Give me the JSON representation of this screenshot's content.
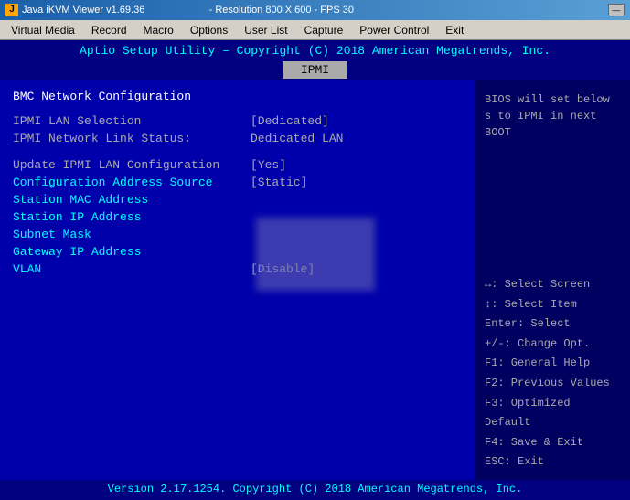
{
  "titlebar": {
    "text": "Java iKVM Viewer v1.69.36",
    "resolution": "- Resolution 800 X 600 - FPS 30",
    "minimize_label": "—"
  },
  "menubar": {
    "items": [
      {
        "label": "Virtual Media"
      },
      {
        "label": "Record"
      },
      {
        "label": "Macro"
      },
      {
        "label": "Options"
      },
      {
        "label": "User List"
      },
      {
        "label": "Capture"
      },
      {
        "label": "Power Control"
      },
      {
        "label": "Exit"
      }
    ]
  },
  "bios": {
    "header": "Aptio Setup Utility – Copyright (C) 2018 American Megatrends, Inc.",
    "tab": "IPMI",
    "section_title": "BMC Network Configuration",
    "rows": [
      {
        "label": "IPMI LAN Selection",
        "value": "[Dedicated]",
        "highlighted": false
      },
      {
        "label": "IPMI Network Link Status:",
        "value": "Dedicated LAN",
        "highlighted": false
      },
      {
        "spacer": true
      },
      {
        "label": "Update IPMI LAN Configuration",
        "value": "[Yes]",
        "highlighted": false
      },
      {
        "label": "Configuration Address Source",
        "value": "[Static]",
        "highlighted": true
      },
      {
        "label": "Station MAC Address",
        "value": "",
        "highlighted": true
      },
      {
        "label": "Station IP Address",
        "value": "",
        "highlighted": true
      },
      {
        "label": "Subnet Mask",
        "value": "",
        "highlighted": true
      },
      {
        "label": "Gateway IP Address",
        "value": "",
        "highlighted": true
      },
      {
        "label": "VLAN",
        "value": "[Disable]",
        "highlighted": true
      }
    ],
    "help_text": "BIOS will set below s to IPMI in next BOOT",
    "key_help": [
      "↔: Select Screen",
      "↕: Select Item",
      "Enter: Select",
      "+/-: Change Opt.",
      "F1: General Help",
      "F2: Previous Values",
      "F3: Optimized Default",
      "F4: Save & Exit",
      "ESC: Exit"
    ],
    "footer": "Version 2.17.1254. Copyright (C) 2018 American Megatrends, Inc."
  }
}
